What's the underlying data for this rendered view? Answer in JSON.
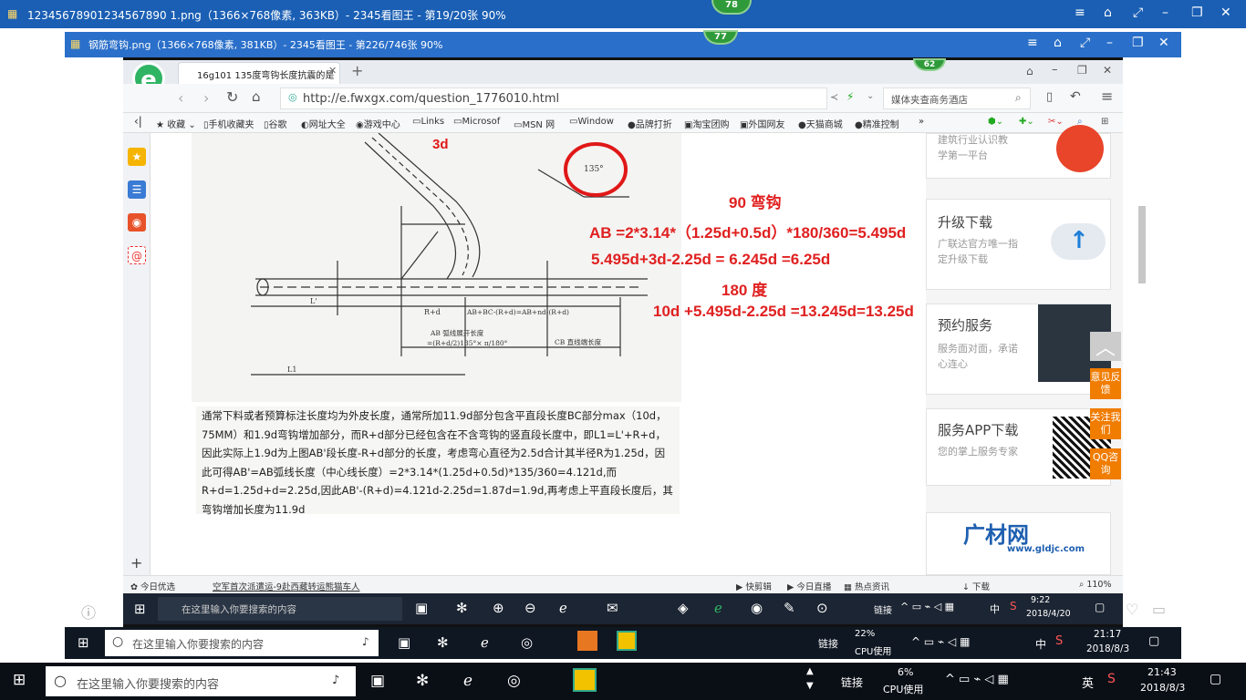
{
  "outer": {
    "title": "12345678901234567890 1.png（1366×768像素, 363KB）- 2345看图王 - 第19/20张 90%",
    "badge": "78"
  },
  "inner": {
    "title": "钢筋弯钩.png（1366×768像素, 381KB）- 2345看图王 - 第226/746张 90%",
    "badge": "77"
  },
  "browser": {
    "tab_title": "16g101 135度弯钩长度抗震的是",
    "badge": "62",
    "url": "http://e.fwxgx.com/question_1776010.html",
    "search_placeholder": "媒体夹查商务酒店",
    "bookmarks": [
      "收藏",
      "手机收藏夹",
      "谷歌",
      "网址大全",
      "游戏中心",
      "Links",
      "Microsof",
      "MSN 网",
      "Window",
      "品牌打折",
      "淘宝团购",
      "外国网友",
      "天猫商城",
      "精准控制"
    ]
  },
  "diagram": {
    "label_3d": "3d",
    "angle": "135°",
    "arc_label": "AB 弧线展开长度",
    "arc_formula": "=(R+d/2)135°× π/180°",
    "cb_label": "CB 直线端长度",
    "rd": "R+d",
    "ab_formula": "AB+BC-(R+d)=AB+nd-(R+d)",
    "L1p": "L'",
    "L1": "L1"
  },
  "notes": {
    "hook90": "90 弯钩",
    "ab_line": "AB  =2*3.14*（1.25d+0.5d）*180/360=5.495d",
    "line2": "5.495d+3d-2.25d = 6.245d =6.25d",
    "deg180": "180 度",
    "line3": "10d +5.495d-2.25d =13.245d=13.25d"
  },
  "paragraph": "通常下料或者预算标注长度均为外皮长度，通常所加11.9d部分包含平直段长度BC部分max（10d，75MM）和1.9d弯钩增加部分，而R+d部分已经包含在不含弯钩的竖直段长度中，即L1=L'+R+d，因此实际上1.9d为上图AB'段长度-R+d部分的长度，考虑弯心直径为2.5d合计其半径R为1.25d，因此可得AB'=AB弧线长度（中心线长度）=2*3.14*(1.25d+0.5d)*135/360=4.121d,而R+d=1.25d+d=2.25d,因此AB'-(R+d)=4.121d-2.25d=1.87d=1.9d,再考虑上平直段长度后，其弯钩增加长度为11.9d",
  "sidebar": {
    "c1_lines": [
      "建筑行业认识教",
      "学第一平台"
    ],
    "c2_title": "升级下载",
    "c2_sub": "广联达官方唯一指定升级下载",
    "c3_title": "预约服务",
    "c3_sub": "服务面对面，承诺心连心",
    "c4_title": "服务APP下载",
    "c4_sub": "您的掌上服务专家",
    "c5_logo": "广材网",
    "c5_url": "www.gldjc.com",
    "f1": "意见反馈",
    "f2": "关注我们",
    "f3": "QQ咨询"
  },
  "status": {
    "left": "今日优选",
    "news": "空军首次派遣运-9赴西藏转运熊猫车人",
    "items": [
      "快剪辑",
      "今日直播",
      "热点资讯",
      "下载"
    ],
    "zoom": "110%"
  },
  "taskbar_inner": {
    "search": "在这里输入你要搜索的内容",
    "link": "链接",
    "lang": "中",
    "time": "9:22",
    "date": "2018/4/20"
  },
  "taskbar_mid": {
    "search": "在这里输入你要搜索的内容",
    "link": "链接",
    "cpu": "22%",
    "cpu_label": "CPU使用",
    "lang": "中",
    "time": "21:17",
    "date": "2018/8/3"
  },
  "taskbar_outer": {
    "search": "在这里输入你要搜索的内容",
    "link": "链接",
    "cpu": "6%",
    "cpu_label": "CPU使用",
    "lang": "英",
    "time": "21:43",
    "date": "2018/8/3"
  }
}
